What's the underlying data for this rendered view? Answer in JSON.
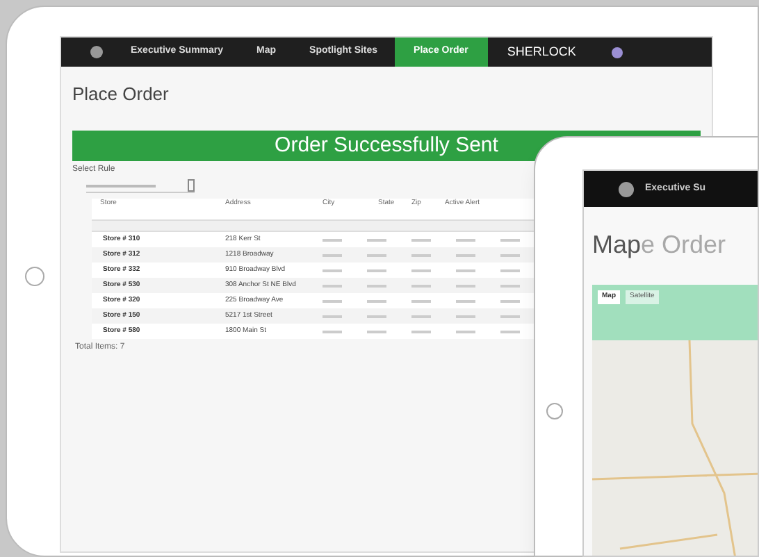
{
  "back_tablet": {
    "nav": [
      {
        "label": "Executive Summary",
        "selected": false
      },
      {
        "label": "Map",
        "selected": false
      },
      {
        "label": "Spotlight Sites",
        "selected": false
      },
      {
        "label": "Place Order",
        "selected": true
      }
    ],
    "brand": "SHERLOCK",
    "page_title": "Place Order",
    "banner": "Order Successfully Sent",
    "select_label": "Select Rule",
    "table": {
      "columns": [
        "Store",
        "Address",
        "City",
        "State",
        "Zip",
        "Active Alert"
      ],
      "rows": [
        {
          "store": "Store # 310",
          "address": "218 Kerr St"
        },
        {
          "store": "Store # 312",
          "address": "1218 Broadway"
        },
        {
          "store": "Store # 332",
          "address": "910 Broadway Blvd"
        },
        {
          "store": "Store # 530",
          "address": "308 Anchor St NE Blvd"
        },
        {
          "store": "Store # 320",
          "address": "225 Broadway Ave"
        },
        {
          "store": "Store # 150",
          "address": "5217 1st Street"
        },
        {
          "store": "Store # 580",
          "address": "1800 Main St"
        }
      ]
    },
    "footer": "Total Items: 7"
  },
  "front_tablet": {
    "nav": [
      {
        "label": "Executive Su",
        "selected": false
      }
    ],
    "page_title": "Map",
    "ghost_title": "e Order",
    "map_tabs": [
      {
        "label": "Map",
        "selected": true
      },
      {
        "label": "Satellite",
        "selected": false
      }
    ]
  }
}
